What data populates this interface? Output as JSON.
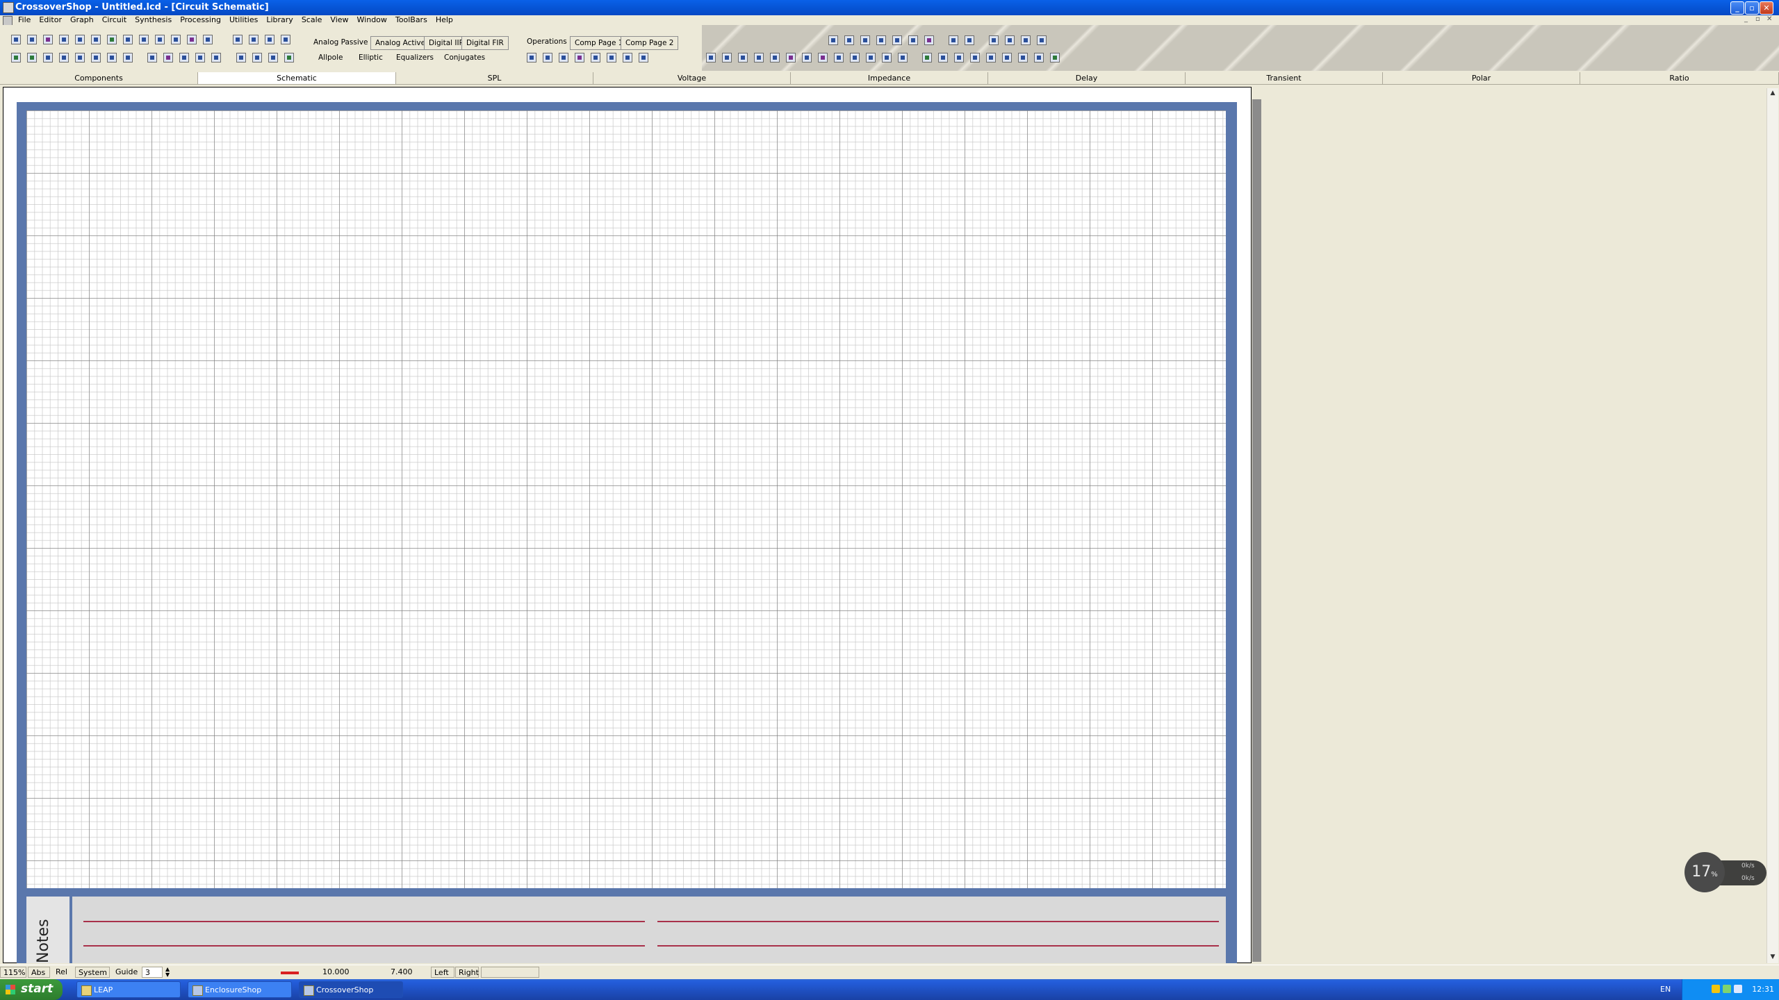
{
  "window": {
    "title": "CrossoverShop - Untitled.lcd - [Circuit Schematic]"
  },
  "menu": [
    "File",
    "Editor",
    "Graph",
    "Circuit",
    "Synthesis",
    "Processing",
    "Utilities",
    "Library",
    "Scale",
    "View",
    "Window",
    "ToolBars",
    "Help"
  ],
  "toolbar": {
    "synth_tabs": [
      "Analog Passive",
      "Analog Active",
      "Digital IIR",
      "Digital FIR"
    ],
    "synth_sub": [
      "Allpole",
      "Elliptic",
      "Equalizers",
      "Conjugates"
    ],
    "ops_tabs": [
      "Operations",
      "Comp Page 1",
      "Comp Page 2"
    ]
  },
  "main_tabs": [
    "Components",
    "Schematic",
    "SPL",
    "Voltage",
    "Impedance",
    "Delay",
    "Transient",
    "Polar",
    "Ratio"
  ],
  "active_tab": "Schematic",
  "notes": {
    "label": "Notes"
  },
  "net_widget": {
    "value": "17",
    "unit": "%",
    "up": "0k/s",
    "down": "0k/s"
  },
  "status": {
    "zoom": "115%",
    "abs": "Abs",
    "rel": "Rel",
    "system": "System",
    "guide": "Guide",
    "spin_value": "3",
    "value1": "10.000",
    "value2": "7.400",
    "left": "Left",
    "right": "Right"
  },
  "taskbar": {
    "start": "start",
    "tasks": [
      "LEAP",
      "EnclosureShop",
      "CrossoverShop"
    ],
    "lang": "EN",
    "clock": "12:31"
  },
  "colors": {
    "sheet_border": "#5a77ac",
    "note_line": "#a8304a",
    "titlebar": "#0757d9"
  }
}
